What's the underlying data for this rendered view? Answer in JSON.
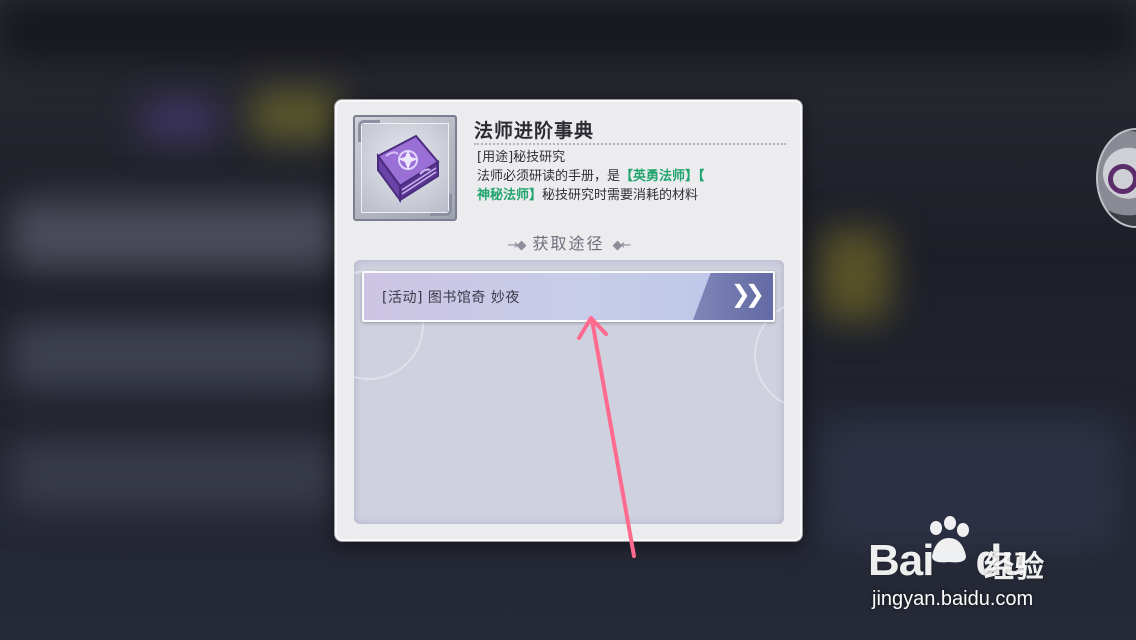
{
  "item": {
    "name": "法师进阶事典",
    "usage_line": "[用途]秘技研究",
    "desc_prefix": "法师必须研读的手册，是",
    "class_1": "【英勇法师】【",
    "class_2": "神秘法师】",
    "desc_suffix": "秘技研究时需要消耗的材料",
    "icon": "purple-spellbook-icon",
    "highlight_color": "#22a56f"
  },
  "sources": {
    "title": "获取途径",
    "rows": [
      {
        "label": "[活动] 图书馆奇 妙夜",
        "action_icon": "double-chevron-right-icon"
      }
    ]
  },
  "annotation": {
    "type": "arrow",
    "color": "#ff6b8f"
  },
  "watermark": {
    "brand": "Bai",
    "brand_suffix": "du",
    "cn": "经验",
    "url": "jingyan.baidu.com"
  }
}
